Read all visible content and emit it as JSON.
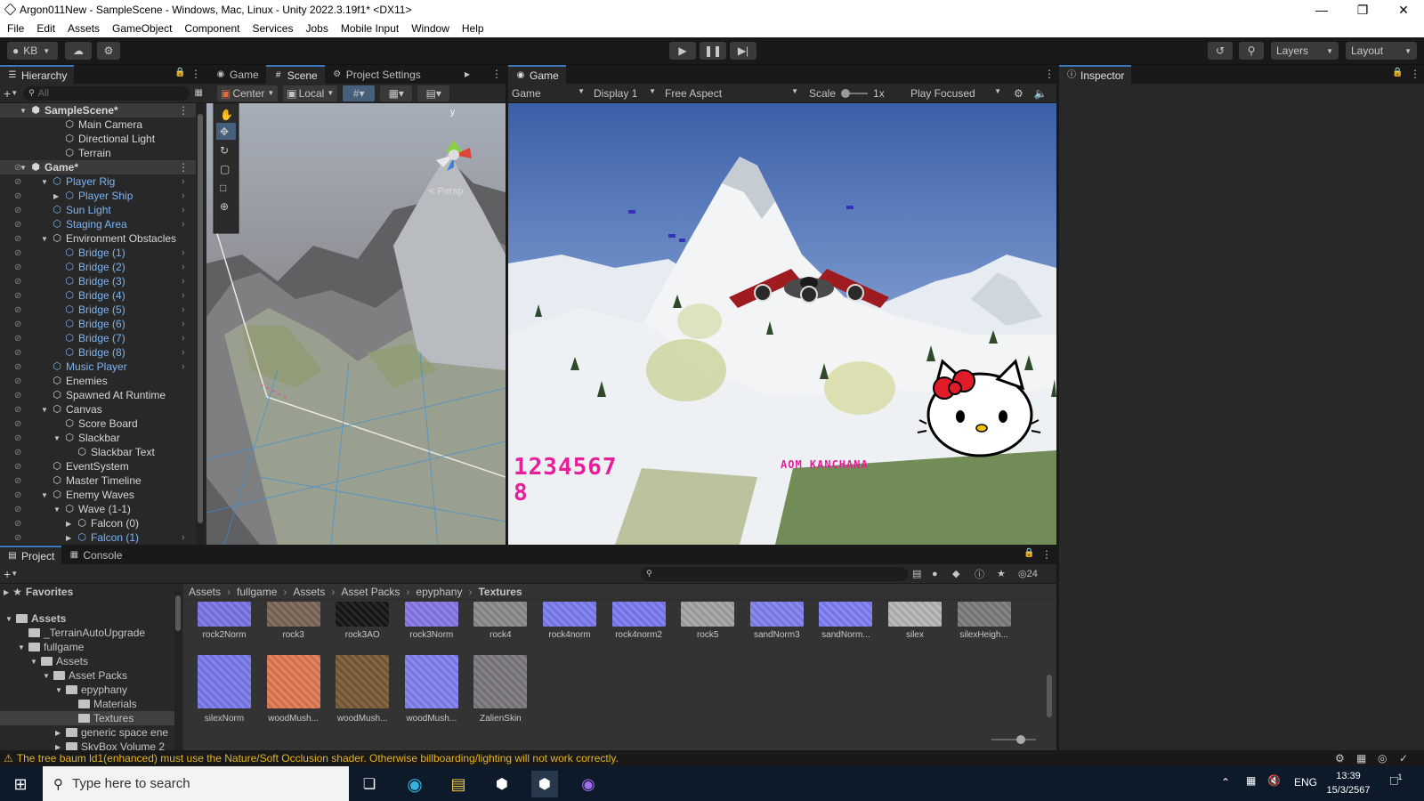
{
  "window": {
    "title": "Argon011New - SampleScene - Windows, Mac, Linux - Unity 2022.3.19f1* <DX11>"
  },
  "menu": [
    "File",
    "Edit",
    "Assets",
    "GameObject",
    "Component",
    "Services",
    "Jobs",
    "Mobile Input",
    "Window",
    "Help"
  ],
  "toolbar": {
    "account": "KB",
    "layers": "Layers",
    "layout": "Layout"
  },
  "hierarchy": {
    "tab": "Hierarchy",
    "search_placeholder": "All",
    "rows": [
      {
        "label": "SampleScene*",
        "indent": 0,
        "style": "scene"
      },
      {
        "label": "Main Camera",
        "indent": 2,
        "style": "white"
      },
      {
        "label": "Directional Light",
        "indent": 2,
        "style": "white"
      },
      {
        "label": "Terrain",
        "indent": 2,
        "style": "white"
      },
      {
        "label": "Game*",
        "indent": 0,
        "style": "scene"
      },
      {
        "label": "Player Rig",
        "indent": 1,
        "style": "blue"
      },
      {
        "label": "Player Ship",
        "indent": 2,
        "style": "blue"
      },
      {
        "label": "Sun Light",
        "indent": 1,
        "style": "blue"
      },
      {
        "label": "Staging Area",
        "indent": 1,
        "style": "blue"
      },
      {
        "label": "Environment Obstacles",
        "indent": 1,
        "style": "white"
      },
      {
        "label": "Bridge (1)",
        "indent": 2,
        "style": "blue"
      },
      {
        "label": "Bridge (2)",
        "indent": 2,
        "style": "blue"
      },
      {
        "label": "Bridge (3)",
        "indent": 2,
        "style": "blue"
      },
      {
        "label": "Bridge (4)",
        "indent": 2,
        "style": "blue"
      },
      {
        "label": "Bridge (5)",
        "indent": 2,
        "style": "blue"
      },
      {
        "label": "Bridge (6)",
        "indent": 2,
        "style": "blue"
      },
      {
        "label": "Bridge (7)",
        "indent": 2,
        "style": "blue"
      },
      {
        "label": "Bridge (8)",
        "indent": 2,
        "style": "blue"
      },
      {
        "label": "Music Player",
        "indent": 1,
        "style": "blue"
      },
      {
        "label": "Enemies",
        "indent": 1,
        "style": "white"
      },
      {
        "label": "Spawned At Runtime",
        "indent": 1,
        "style": "white"
      },
      {
        "label": "Canvas",
        "indent": 1,
        "style": "white"
      },
      {
        "label": "Score Board",
        "indent": 2,
        "style": "white"
      },
      {
        "label": "Slackbar",
        "indent": 2,
        "style": "white"
      },
      {
        "label": "Slackbar Text",
        "indent": 3,
        "style": "white"
      },
      {
        "label": "EventSystem",
        "indent": 1,
        "style": "white"
      },
      {
        "label": "Master Timeline",
        "indent": 1,
        "style": "white"
      },
      {
        "label": "Enemy Waves",
        "indent": 1,
        "style": "white"
      },
      {
        "label": "Wave (1-1)",
        "indent": 2,
        "style": "white"
      },
      {
        "label": "Falcon (0)",
        "indent": 3,
        "style": "white"
      },
      {
        "label": "Falcon (1)",
        "indent": 3,
        "style": "blue"
      }
    ]
  },
  "scene_tabs": [
    "Game",
    "Scene",
    "Project Settings"
  ],
  "scene": {
    "pivot": "Center",
    "space": "Local",
    "persp": "< Persp",
    "axis_y": "y"
  },
  "game": {
    "tab": "Game",
    "mode": "Game",
    "display": "Display 1",
    "aspect": "Free Aspect",
    "scale_label": "Scale",
    "scale_value": "1x",
    "play_focused": "Play Focused",
    "score": "1234567\n8",
    "player_name": "AOM KANCHANA"
  },
  "inspector": {
    "tab": "Inspector"
  },
  "project": {
    "tabs": [
      "Project",
      "Console"
    ],
    "hidden_count": "24",
    "favorites": "Favorites",
    "breadcrumb": [
      "Assets",
      "fullgame",
      "Assets",
      "Asset Packs",
      "epyphany",
      "Textures"
    ],
    "tree": [
      {
        "label": "Assets",
        "indent": 0,
        "bold": true
      },
      {
        "label": "_TerrainAutoUpgrade",
        "indent": 1
      },
      {
        "label": "fullgame",
        "indent": 1
      },
      {
        "label": "Assets",
        "indent": 2
      },
      {
        "label": "Asset Packs",
        "indent": 3
      },
      {
        "label": "epyphany",
        "indent": 4
      },
      {
        "label": "Materials",
        "indent": 5
      },
      {
        "label": "Textures",
        "indent": 5,
        "selected": true
      },
      {
        "label": "generic space ene",
        "indent": 4
      },
      {
        "label": "SkyBox Volume 2",
        "indent": 4
      }
    ],
    "assets_row1": [
      {
        "name": "rock2Norm",
        "color": "#7a73e6"
      },
      {
        "name": "rock3",
        "color": "#7a6655"
      },
      {
        "name": "rock3AO",
        "color": "#151515"
      },
      {
        "name": "rock3Norm",
        "color": "#8578e6"
      },
      {
        "name": "rock4",
        "color": "#8a8a8a"
      },
      {
        "name": "rock4norm",
        "color": "#7c7cf0"
      },
      {
        "name": "rock4norm2",
        "color": "#7a7af2"
      },
      {
        "name": "rock5",
        "color": "#a3a3a3"
      },
      {
        "name": "sandNorm3",
        "color": "#8080ee"
      },
      {
        "name": "sandNorm...",
        "color": "#7f7ff5"
      },
      {
        "name": "silex",
        "color": "#b5b5b5"
      },
      {
        "name": "silexHeigh...",
        "color": "#7b7b7b"
      }
    ],
    "assets_row2": [
      {
        "name": "silexNorm",
        "color": "#7a7aee"
      },
      {
        "name": "woodMush...",
        "color": "#e07a55"
      },
      {
        "name": "woodMush...",
        "color": "#7a5a35"
      },
      {
        "name": "woodMush...",
        "color": "#8080f0"
      },
      {
        "name": "ZalienSkin",
        "color": "#7b777d"
      }
    ]
  },
  "status": {
    "message": "The tree baum ld1(enhanced) must use the Nature/Soft Occlusion shader. Otherwise billboarding/lighting will not work correctly."
  },
  "taskbar": {
    "search_placeholder": "Type here to search",
    "lang": "ENG",
    "time": "13:39",
    "date": "15/3/2567",
    "notif": "1"
  }
}
